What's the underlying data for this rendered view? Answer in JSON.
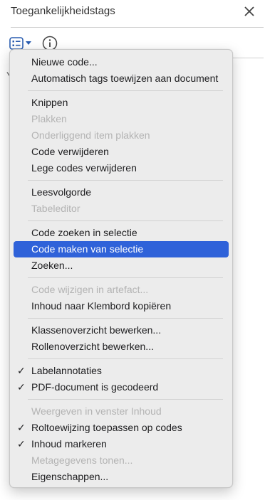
{
  "panel": {
    "title": "Toegankelijkheidstags",
    "close_icon": "close-icon",
    "hidden_char": "Y"
  },
  "toolbar": {
    "options_icon": "tag-options-icon",
    "info_icon": "info-icon"
  },
  "menu": {
    "items": [
      {
        "label": "Nieuwe code...",
        "enabled": true
      },
      {
        "label": "Automatisch tags toewijzen aan document",
        "enabled": true
      },
      {
        "label": "Knippen",
        "enabled": true
      },
      {
        "label": "Plakken",
        "enabled": false
      },
      {
        "label": "Onderliggend item plakken",
        "enabled": false
      },
      {
        "label": "Code verwijderen",
        "enabled": true
      },
      {
        "label": "Lege codes verwijderen",
        "enabled": true
      },
      {
        "label": "Leesvolgorde",
        "enabled": true
      },
      {
        "label": "Tabeleditor",
        "enabled": false
      },
      {
        "label": "Code zoeken in selectie",
        "enabled": true
      },
      {
        "label": "Code maken van selectie",
        "enabled": true,
        "highlighted": true
      },
      {
        "label": "Zoeken...",
        "enabled": true
      },
      {
        "label": "Code wijzigen in artefact...",
        "enabled": false
      },
      {
        "label": "Inhoud naar Klembord kopiëren",
        "enabled": true
      },
      {
        "label": "Klassenoverzicht bewerken...",
        "enabled": true
      },
      {
        "label": "Rollenoverzicht bewerken...",
        "enabled": true
      },
      {
        "label": "Labelannotaties",
        "enabled": true,
        "checked": true
      },
      {
        "label": "PDF-document is gecodeerd",
        "enabled": true,
        "checked": true
      },
      {
        "label": "Weergeven in venster Inhoud",
        "enabled": false
      },
      {
        "label": "Roltoewijzing toepassen op codes",
        "enabled": true,
        "checked": true
      },
      {
        "label": "Inhoud markeren",
        "enabled": true,
        "checked": true
      },
      {
        "label": "Metagegevens tonen...",
        "enabled": false
      },
      {
        "label": "Eigenschappen...",
        "enabled": true
      }
    ],
    "check_glyph": "✓"
  },
  "colors": {
    "highlight": "#2f62d9",
    "menu_bg": "#ececec",
    "disabled_text": "#b3b3b3"
  }
}
